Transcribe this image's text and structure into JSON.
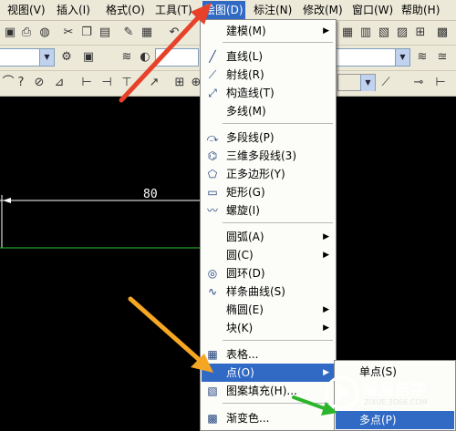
{
  "menubar": {
    "items": [
      {
        "label": "视图(V)"
      },
      {
        "label": "插入(I)"
      },
      {
        "label": "格式(O)"
      },
      {
        "label": "工具(T)"
      },
      {
        "label": "绘图(D)"
      },
      {
        "label": "标注(N)"
      },
      {
        "label": "修改(M)"
      },
      {
        "label": "窗口(W)"
      },
      {
        "label": "帮助(H)"
      }
    ]
  },
  "drawing": {
    "dimension_value": "80"
  },
  "draw_menu": {
    "items": [
      {
        "label": "建模(M)",
        "icon": "none",
        "submenu": true
      },
      {
        "label": "直线(L)",
        "icon": "line-icon"
      },
      {
        "label": "射线(R)",
        "icon": "ray-icon"
      },
      {
        "label": "构造线(T)",
        "icon": "construction-line-icon"
      },
      {
        "label": "多线(M)",
        "icon": "none"
      },
      {
        "label": "多段线(P)",
        "icon": "polyline-icon"
      },
      {
        "label": "三维多段线(3)",
        "icon": "3d-polyline-icon"
      },
      {
        "label": "正多边形(Y)",
        "icon": "polygon-icon"
      },
      {
        "label": "矩形(G)",
        "icon": "rectangle-icon"
      },
      {
        "label": "螺旋(I)",
        "icon": "helix-icon"
      },
      {
        "label": "圆弧(A)",
        "icon": "none",
        "submenu": true
      },
      {
        "label": "圆(C)",
        "icon": "none",
        "submenu": true
      },
      {
        "label": "圆环(D)",
        "icon": "donut-icon"
      },
      {
        "label": "样条曲线(S)",
        "icon": "spline-icon"
      },
      {
        "label": "椭圆(E)",
        "icon": "none",
        "submenu": true
      },
      {
        "label": "块(K)",
        "icon": "none",
        "submenu": true
      },
      {
        "label": "表格...",
        "icon": "table-icon"
      },
      {
        "label": "点(O)",
        "icon": "none",
        "submenu": true
      },
      {
        "label": "图案填充(H)...",
        "icon": "hatch-icon"
      },
      {
        "label": "渐变色...",
        "icon": "gradient-icon"
      }
    ]
  },
  "point_submenu": {
    "items": [
      {
        "label": "单点(S)"
      },
      {
        "label": "多点(P)"
      }
    ]
  },
  "watermark": {
    "title": "溜溜自学",
    "url": "ZIXUE.3D66.COM"
  },
  "colors": {
    "menu_highlight": "#316ac5",
    "toolbar_bg": "#ece9d8",
    "canvas_bg": "#000000",
    "arrow_red": "#e8412a",
    "arrow_orange": "#f5a623",
    "arrow_green": "#2bb52b"
  }
}
